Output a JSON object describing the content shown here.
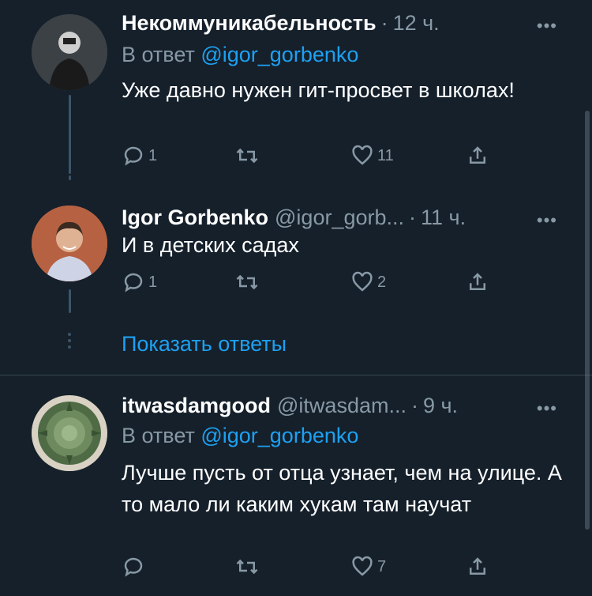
{
  "tweets": [
    {
      "name": "Некоммуникабельность",
      "handle": "",
      "sep": "·",
      "time": "12 ч.",
      "reply_prefix": "В ответ",
      "reply_mention": "@igor_gorbenko",
      "text": "Уже давно нужен гит-просвет в школах!",
      "replies": "1",
      "retweets": "",
      "likes": "11"
    },
    {
      "name": "Igor Gorbenko",
      "handle": "@igor_gorb...",
      "sep": "·",
      "time": "11 ч.",
      "text": "И в детских садах",
      "replies": "1",
      "retweets": "",
      "likes": "2"
    },
    {
      "name": "itwasdamgood",
      "handle": "@itwasdam...",
      "sep": "·",
      "time": "9 ч.",
      "reply_prefix": "В ответ",
      "reply_mention": "@igor_gorbenko",
      "text": "Лучше пусть от отца узнает, чем на улице. А то мало ли каким хукам там научат",
      "replies": "",
      "retweets": "",
      "likes": "7"
    }
  ],
  "show_replies_label": "Показать ответы",
  "more_label": "•••",
  "colors": {
    "background": "#15202b",
    "secondary_text": "#8899a6",
    "accent": "#1da1f2",
    "thread_line": "#3d5466"
  },
  "icons": [
    "reply-icon",
    "retweet-icon",
    "like-icon",
    "share-icon",
    "more-icon"
  ]
}
